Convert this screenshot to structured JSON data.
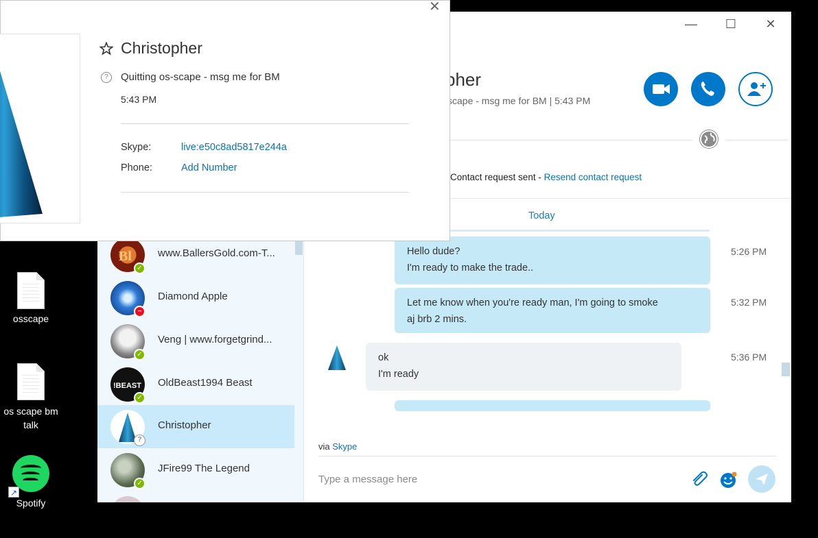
{
  "desktop": {
    "icons": [
      {
        "label": "osscape"
      },
      {
        "label": "os scape bm talk"
      },
      {
        "label": "Spotify"
      }
    ]
  },
  "window_controls": {
    "minimize": "—",
    "maximize": "☐",
    "close": "✕"
  },
  "contacts": [
    {
      "name": "www.BallersGold.com-T...",
      "status": "online"
    },
    {
      "name": "Diamond Apple",
      "status": "dnd"
    },
    {
      "name": "Veng | www.forgetgrind...",
      "status": "online"
    },
    {
      "name": "OldBeast1994 Beast",
      "status": "online"
    },
    {
      "name": "Christopher",
      "status": "unknown"
    },
    {
      "name": "JFire99 The Legend",
      "status": "online"
    }
  ],
  "conversation": {
    "header_name_partial": "pher",
    "header_status_partial": "scape - msg me for BM  |  5:43 PM",
    "request_text": "Contact request sent - ",
    "request_link": "Resend contact request",
    "day_label": "Today",
    "messages": [
      {
        "direction": "out",
        "lines": [
          "Hello dude?",
          "I'm ready to make the trade.."
        ],
        "time": "5:26 PM"
      },
      {
        "direction": "out",
        "lines": [
          "Let me know when you're ready man, I'm going to smoke",
          "aj brb 2 mins."
        ],
        "time": "5:32 PM"
      },
      {
        "direction": "in",
        "lines": [
          "ok",
          "I'm ready"
        ],
        "time": "5:36 PM"
      }
    ],
    "via_prefix": "via ",
    "via_link": "Skype",
    "input_placeholder": "Type a message here"
  },
  "profile": {
    "name": "Christopher",
    "mood": "Quitting os-scape - msg me for BM",
    "time": "5:43 PM",
    "skype_label": "Skype:",
    "skype_value": "live:e50c8ad5817e244a",
    "phone_label": "Phone:",
    "phone_value": "Add Number"
  },
  "colors": {
    "accent": "#0078ca",
    "outgoing_bubble": "#c6e9f8",
    "selected_contact": "#c9eafa"
  }
}
